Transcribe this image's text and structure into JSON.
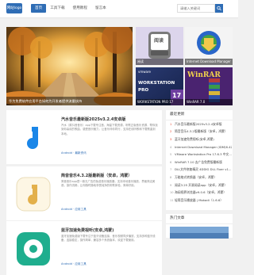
{
  "header": {
    "logo_text": "网站logo",
    "nav": [
      "首页",
      "工具下载",
      "使用教程",
      "留言本"
    ],
    "search_placeholder": "请输入关键词"
  },
  "banner": {
    "caption": "华为免费软件应用平台如何为开发者提供流量扶持"
  },
  "tiles": [
    {
      "caption": "阅读"
    },
    {
      "caption": "Internet Download Manager"
    },
    {
      "caption": "WORKSTATION PRO 17"
    },
    {
      "caption": "WinRAR 7.0"
    }
  ],
  "tile_text": {
    "reader": "阅读",
    "vmware_brand": "vmware",
    "workstation": "WORKSTATION",
    "pro": "PRO",
    "version": "17",
    "winrar": "WinRAR"
  },
  "cards": [
    {
      "title": "汽水音乐最新版2025v3.2.4安卓版",
      "desc": "汽水（原抖音音乐）app下载专注音，海量下载资源，听歌正版音乐资源，帮你找到你喜欢的歌曲，感受音乐魅力，让音乐伴你同行，支持在线听歌和下载歌曲到本地。",
      "tag": "Android · 最新资讯"
    },
    {
      "title": "简音音乐4.3.2版最新版（安卓，鸿蒙）",
      "desc": "简音音乐app是一款无广告的免费音乐播放器，支持本地音乐播放，界面简洁美观，操作流畅，让你随时随地享受纯净的听歌体验，简单好用。",
      "tag": "Android · 应用工具"
    },
    {
      "title": "蓝牙加速免费视听(安卓,鸿蒙)",
      "desc": "蓝牙加速免费版下载专注于蓝牙设备连接，音乐视频同步播放，支持多种蓝牙设备，连接稳定，操作简单，兼容多个系统版本，欢迎下载使用。",
      "tag": "Android · 应用工具"
    }
  ],
  "sidebar_latest": {
    "title": "最近更新",
    "items": [
      "汽水音乐最新版2025v3.2.4安卓版",
      "简音音乐4.3.2版最新版（安卓，鸿蒙）",
      "蓝牙加速免费视听(安卓,鸿蒙)",
      "Internet Download Manager (IDM)6.42 23...",
      "VMware Workstation Pro 17.6.3 中文...",
      "WinRAR 7.10 去广告免费版最新版",
      "DLL文件修复精灵 4DDIG DLL Fixer v1...",
      "万能格式转换器（安卓，鸿蒙）",
      "阅读3.25 开源阅读app（安卓，鸿蒙）",
      "海阔视界浏览器v9.0.6（安卓，鸿蒙）",
      "轻简音乐播放器 | Mokadi（1.6.6）",
      "简音音乐4.3.2版（安卓，鸿蒙）"
    ]
  },
  "sidebar_hot": {
    "title": "热门文章"
  },
  "colors": {
    "accent": "#2f6db5",
    "hot": "#e8412a"
  }
}
